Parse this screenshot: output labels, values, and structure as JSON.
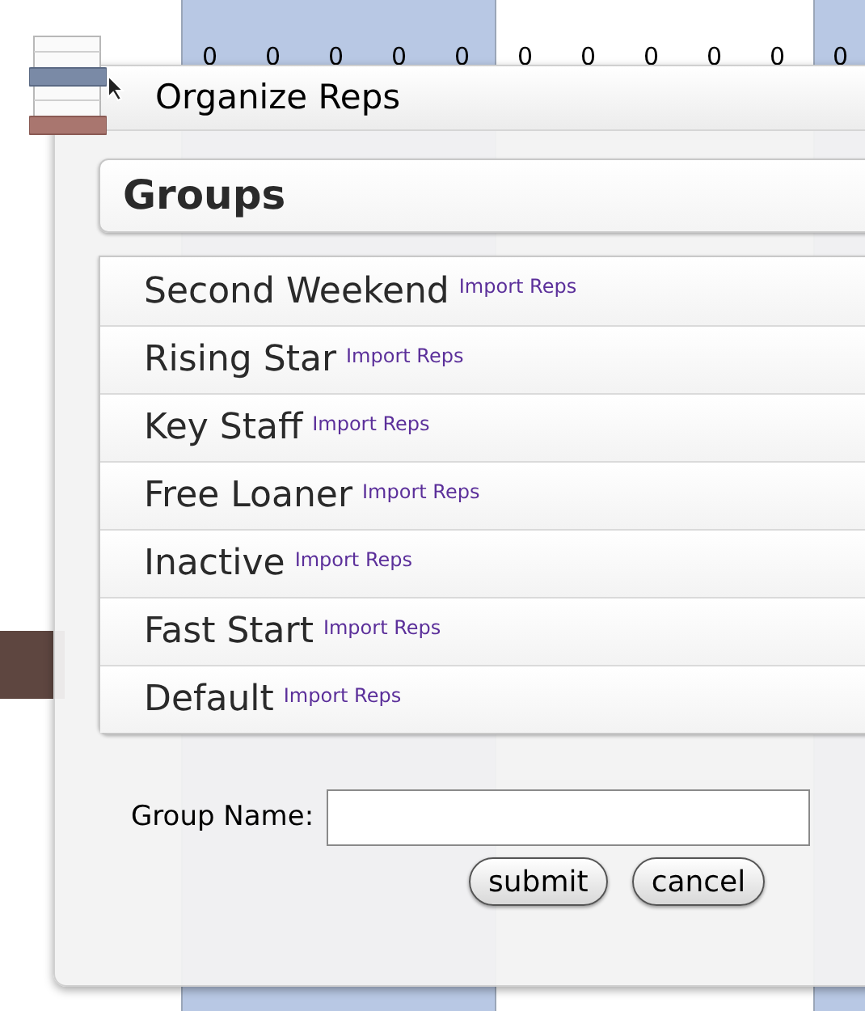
{
  "background_grid": {
    "row": [
      "0",
      "0",
      "0",
      "0",
      "0",
      "0",
      "0",
      "0",
      "0",
      "0",
      "0"
    ]
  },
  "dialog": {
    "title": "Organize Reps",
    "groups": {
      "heading": "Groups",
      "items": [
        {
          "name": "Second Weekend",
          "link": "Import Reps"
        },
        {
          "name": "Rising Star",
          "link": "Import Reps"
        },
        {
          "name": "Key Staff",
          "link": "Import Reps"
        },
        {
          "name": "Free Loaner",
          "link": "Import Reps"
        },
        {
          "name": "Inactive",
          "link": "Import Reps"
        },
        {
          "name": "Fast Start",
          "link": "Import Reps"
        },
        {
          "name": "Default",
          "link": "Import Reps"
        }
      ]
    },
    "form": {
      "label": "Group Name:",
      "buttons": [
        "submit",
        "cancel"
      ]
    }
  }
}
